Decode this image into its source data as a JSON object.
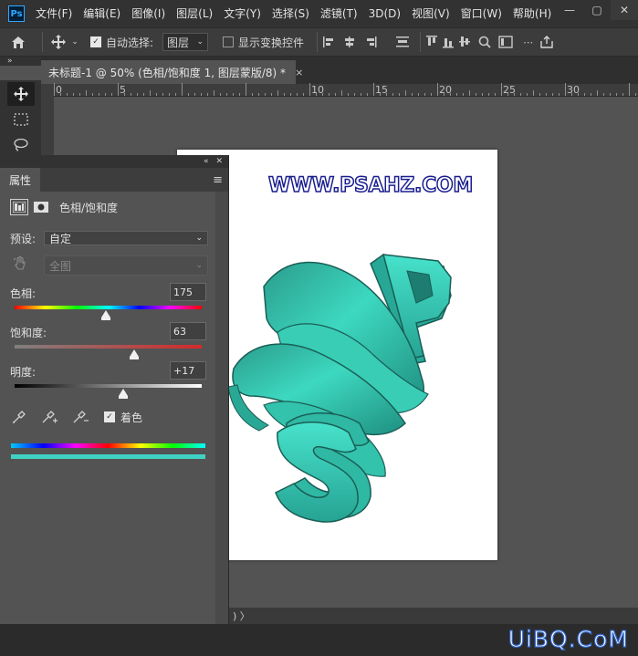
{
  "app": {
    "logo": "Ps"
  },
  "menu": [
    "文件(F)",
    "编辑(E)",
    "图像(I)",
    "图层(L)",
    "文字(Y)",
    "选择(S)",
    "滤镜(T)",
    "3D(D)",
    "视图(V)",
    "窗口(W)",
    "帮助(H)"
  ],
  "window_controls": {
    "minimize": "—",
    "maximize": "▢",
    "close": "✕"
  },
  "options": {
    "auto_select_label": "自动选择:",
    "auto_select_checked": true,
    "auto_select_target": "图层",
    "show_transform_label": "显示变换控件",
    "show_transform_checked": false
  },
  "document": {
    "tab_title": "未标题-1 @ 50% (色相/饱和度 1, 图层蒙版/8) *",
    "close": "×"
  },
  "ruler": {
    "labels": [
      "0",
      "5",
      "10",
      "15",
      "20",
      "25",
      "30"
    ]
  },
  "artwork": {
    "watermark": "WWW.PSAHZ.COM",
    "letter_p": "P",
    "letter_s": "S",
    "color": "#2fc2a8"
  },
  "properties": {
    "tab": "属性",
    "adjustment_title": "色相/饱和度",
    "preset_label": "预设:",
    "preset_value": "自定",
    "channel_value": "全图",
    "hue_label": "色相:",
    "hue_value": "175",
    "hue_level": 0.49,
    "saturation_label": "饱和度:",
    "saturation_value": "63",
    "saturation_level": 0.64,
    "lightness_label": "明度:",
    "lightness_value": "+17",
    "lightness_level": 0.58,
    "colorize_label": "着色",
    "colorize_checked": true,
    "colorize_color": "#3fd2c4"
  },
  "status": {
    "text": ") 〉"
  },
  "corner_logo": "UiBQ.CoM"
}
